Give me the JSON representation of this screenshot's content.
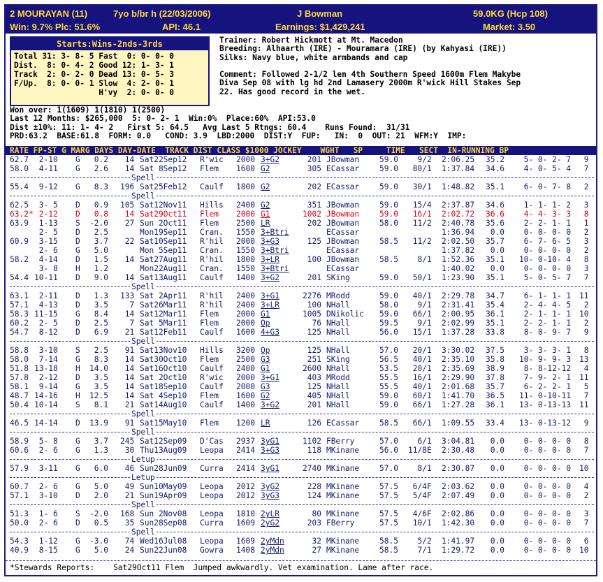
{
  "header": {
    "horse": "2 MOURAYAN (11)",
    "age_desc": "7yo b/br h (22/03/2006)",
    "jockey": "J Bowman",
    "weight": "59.0KG (Hcp 108)",
    "win_plc": "Win: 9.7% Plc: 51.6%",
    "api": "API: 46.1",
    "earnings": "Earnings: $1,429,241",
    "market": "Market: 3.50"
  },
  "starts_box": {
    "title": "Starts:Wins-2nds-3rds",
    "lines": [
      "Total 31: 3- 8- 5 Fast  0: 0- 0- 0",
      "Dist.  8: 0- 4- 2 Good 12: 1- 3- 1",
      "Track  2: 0- 2- 0 Dead 13: 0- 5- 3",
      "F/Up.  8: 0- 0- 1 Slow  4: 2- 0- 1",
      "                  H'vy  2: 0- 0- 0"
    ]
  },
  "info_lines": [
    "Trainer: Robert Hickmott at Mt. Macedon",
    "Breeding: Alhaarth (IRE) - Mouramara (IRE) (by Kahyasi (IRE))",
    "Silks: Navy blue, white armbands and cap",
    "",
    "Comment: Followed 2-1/2 len 4th Southern Speed 1600m Flem Makybe",
    "Diva Sep 08 with lg hd 2nd Lamasery 2000m R'wick Hill Stakes Sep",
    "22. Has good record in the wet."
  ],
  "summary_lines": [
    "Won over: 1(1609) 1(1810) 1(2500)",
    "Last 12 Months: $265,000  5: 0- 2- 1  Win:0%  Place:60%  API:53.0",
    "Dist ±10%: 11: 1- 4- 2   First 5: 64.5   Avg Last 5 Rtngs: 60.4    Runs Found:  31/31",
    "PRD:63.2  BASE:61.8  FORM: 0.0   COND: 3.9  LBD:2000  DIST:Y  FUP:   IN:  0  OUT: 21  WFM:Y  IMP:"
  ],
  "column_header": "RATE FP-ST G MARG DAYS DAY-DATE  TRACK DIST CLASS $1000 JOCKEY    WGHT   SP     TIME   SECT  IN-RUNNING BP",
  "form_rows": [
    {
      "t": "r",
      "rate": "62.7",
      "fpst": " 2-10",
      "g": "G",
      "marg": " 0.2",
      "days": " 14",
      "date": "Sat22Sep12",
      "track": "R'wic",
      "dist": "2000",
      "cls": "3+G2",
      "prize": " 201",
      "jockey": "JBowman",
      "wght": "59.0",
      "sp": "  9/2",
      "time": "2:06.25",
      "sect": "35.2",
      "run": " 5- 0- 2- 7",
      "bp": " 9"
    },
    {
      "t": "r",
      "rate": "58.0",
      "fpst": " 4-11",
      "g": "G",
      "marg": " 2.6",
      "days": " 14",
      "date": "Sat 8Sep12",
      "track": "Flem ",
      "dist": "1600",
      "cls": "G2",
      "prize": " 305",
      "jockey": "ECassar",
      "wght": "59.0",
      "sp": " 80/1",
      "time": "1:37.84",
      "sect": "34.6",
      "run": " 4- 0- 5- 4",
      "bp": " 7"
    },
    {
      "t": "s",
      "label": "Spell"
    },
    {
      "t": "r",
      "rate": "55.4",
      "fpst": " 9-12",
      "g": "G",
      "marg": " 8.3",
      "days": "196",
      "date": "Sat25Feb12",
      "track": "Caulf",
      "dist": "1800",
      "cls": "G2",
      "prize": " 202",
      "jockey": "ECassar",
      "wght": "59.0",
      "sp": " 30/1",
      "time": "1:48.82",
      "sect": "35.1",
      "run": " 6- 0- 7- 8",
      "bp": " 2"
    },
    {
      "t": "s",
      "label": "Spell"
    },
    {
      "t": "r",
      "rate": "62.5",
      "fpst": " 3- 5",
      "g": "D",
      "marg": " 0.9",
      "days": "105",
      "date": "Sat12Nov11",
      "track": "Hills",
      "dist": "2400",
      "cls": "G2",
      "prize": " 351",
      "jockey": "JBowman",
      "wght": "59.0",
      "sp": " 15/4",
      "time": "2:37.87",
      "sect": "34.6",
      "run": " 1- 1- 1- 2",
      "bp": " 3"
    },
    {
      "t": "r",
      "hl": true,
      "rate": "63.2*",
      "fpst": " 2-12",
      "g": "D",
      "marg": " 0.8",
      "days": " 14",
      "date": "Sat29Oct11",
      "track": "Flem ",
      "dist": "2000",
      "cls": "G1",
      "prize": "1002",
      "jockey": "JBowman",
      "wght": "59.0",
      "sp": " 16/1",
      "time": "2:02.72",
      "sect": "36.6",
      "run": " 4- 4- 3- 3",
      "bp": " 8"
    },
    {
      "t": "r",
      "rate": "63.9",
      "fpst": " 1-13",
      "g": "S",
      "marg": "-2.0",
      "days": " 27",
      "date": "Sun 2Oct11",
      "track": "Flem ",
      "dist": "2500",
      "cls": "LR",
      "prize": " 202",
      "jockey": "JBowman",
      "wght": "58.0",
      "sp": " 11/2",
      "time": "2:40.78",
      "sect": "35.6",
      "run": " 2- 2- 1- 1",
      "bp": " 1"
    },
    {
      "t": "r",
      "rate": "",
      "fpst": " 2- 5",
      "g": "D",
      "marg": " 2.5",
      "days": "",
      "date": "Mon19Sep11",
      "track": "Cran.",
      "dist": "1550",
      "cls": "3+Btri",
      "prize": "",
      "jockey": "ECassar",
      "wght": "",
      "sp": "",
      "time": "1:36.94",
      "sect": " 0.0",
      "run": " 0- 0- 0- 0",
      "bp": " 2"
    },
    {
      "t": "r",
      "rate": "60.9",
      "fpst": " 3-15",
      "g": "D",
      "marg": " 3.7",
      "days": " 22",
      "date": "Sat10Sep11",
      "track": "R'hil",
      "dist": "2000",
      "cls": "3+G3",
      "prize": " 125",
      "jockey": "JBowman",
      "wght": "58.5",
      "sp": " 11/2",
      "time": "2:02.50",
      "sect": "35.7",
      "run": " 6- 7- 6- 5",
      "bp": " 3"
    },
    {
      "t": "r",
      "rate": "",
      "fpst": " 2- 6",
      "g": "G",
      "marg": " 5.0",
      "days": "",
      "date": "Mon 5Sep11",
      "track": "Cran.",
      "dist": "1550",
      "cls": "3+Btri",
      "prize": "",
      "jockey": "ECassar",
      "wght": "",
      "sp": "",
      "time": "1:37.82",
      "sect": " 0.0",
      "run": " 0- 0- 0- 0",
      "bp": " 2"
    },
    {
      "t": "r",
      "rate": "58.2",
      "fpst": " 4-14",
      "g": "D",
      "marg": " 1.5",
      "days": " 14",
      "date": "Sat27Aug11",
      "track": "R'hil",
      "dist": "1800",
      "cls": "3+LR",
      "prize": " 100",
      "jockey": "JBowman",
      "wght": "58.5",
      "sp": "  8/1",
      "time": "1:52.36",
      "sect": "35.1",
      "run": "10- 0-10- 4",
      "bp": " 8"
    },
    {
      "t": "r",
      "rate": "",
      "fpst": " 3- 8",
      "g": "H",
      "marg": " 1.2",
      "days": "",
      "date": "Mon22Aug11",
      "track": "Cran.",
      "dist": "1550",
      "cls": "3+Btri",
      "prize": "",
      "jockey": "ECassar",
      "wght": "",
      "sp": "",
      "time": "1:40.02",
      "sect": " 0.0",
      "run": " 0- 0- 0- 0",
      "bp": " 3"
    },
    {
      "t": "r",
      "rate": "54.4",
      "fpst": "10-11",
      "g": "D",
      "marg": " 9.0",
      "days": " 14",
      "date": "Sat13Aug11",
      "track": "Caulf",
      "dist": "1400",
      "cls": "3+G2",
      "prize": " 201",
      "jockey": "SKing",
      "wght": "59.0",
      "sp": " 50/1",
      "time": "1:23.90",
      "sect": "35.1",
      "run": " 5- 0- 5- 7",
      "bp": " 7"
    },
    {
      "t": "s",
      "label": "Spell"
    },
    {
      "t": "r",
      "rate": "63.1",
      "fpst": " 2-11",
      "g": "D",
      "marg": " 1.3",
      "days": "133",
      "date": "Sat 2Apr11",
      "track": "R'hil",
      "dist": "2400",
      "cls": "3+G1",
      "prize": "2276",
      "jockey": "MRodd",
      "wght": "59.0",
      "sp": " 40/1",
      "time": "2:29.78",
      "sect": "34.7",
      "run": " 6- 1- 1- 1",
      "bp": "11"
    },
    {
      "t": "r",
      "rate": "57.1",
      "fpst": " 4-13",
      "g": "D",
      "marg": " 3.5",
      "days": "  7",
      "date": "Sat26Mar11",
      "track": "R'hil",
      "dist": "2400",
      "cls": "3+LR",
      "prize": " 100",
      "jockey": "NHall",
      "wght": "58.0",
      "sp": "  9/1",
      "time": "2:31.41",
      "sect": "35.4",
      "run": " 2- 4- 4- 5",
      "bp": " 2"
    },
    {
      "t": "r",
      "rate": "58.3",
      "fpst": "11-15",
      "g": "G",
      "marg": " 8.4",
      "days": " 14",
      "date": "Sat12Mar11",
      "track": "Flem ",
      "dist": "2000",
      "cls": "G1",
      "prize": "1005",
      "jockey": "DNikolic",
      "wght": "59.0",
      "sp": " 66/1",
      "time": "2:00.95",
      "sect": "36.1",
      "run": " 2- 1- 1- 1",
      "bp": "10"
    },
    {
      "t": "r",
      "rate": "60.2",
      "fpst": " 2- 5",
      "g": "D",
      "marg": " 2.5",
      "days": "  7",
      "date": "Sat 5Mar11",
      "track": "Flem ",
      "dist": "2000",
      "cls": "Op",
      "prize": "  76",
      "jockey": "NHall",
      "wght": "59.5",
      "sp": "  9/1",
      "time": "2:02.99",
      "sect": "35.1",
      "run": " 2- 2- 1- 1",
      "bp": " 2"
    },
    {
      "t": "r",
      "rate": "54.7",
      "fpst": " 8-12",
      "g": "D",
      "marg": " 6.9",
      "days": " 21",
      "date": "Sat12Feb11",
      "track": "Caulf",
      "dist": "1600",
      "cls": "4+G3",
      "prize": " 125",
      "jockey": "NHall",
      "wght": "56.0",
      "sp": " 15/1",
      "time": "1:37.28",
      "sect": "33.8",
      "run": " 8- 0- 9- 7",
      "bp": " 9"
    },
    {
      "t": "s",
      "label": "Spell"
    },
    {
      "t": "r",
      "rate": "58.8",
      "fpst": " 3-10",
      "g": "S",
      "marg": " 2.5",
      "days": " 91",
      "date": "Sat13Nov10",
      "track": "Hills",
      "dist": "3200",
      "cls": "Op",
      "prize": " 125",
      "jockey": "NHall",
      "wght": "57.0",
      "sp": " 20/1",
      "time": "3:30.02",
      "sect": "37.5",
      "run": " 3- 3- 3- 1",
      "bp": " 8"
    },
    {
      "t": "r",
      "rate": "58.0",
      "fpst": " 7-14",
      "g": "G",
      "marg": " 8.3",
      "days": " 14",
      "date": "Sat30Oct10",
      "track": "Flem ",
      "dist": "2500",
      "cls": "G3",
      "prize": " 251",
      "jockey": "SKing",
      "wght": "56.5",
      "sp": " 40/1",
      "time": "2:35.10",
      "sect": "35.8",
      "run": "10- 9- 9- 3",
      "bp": "13"
    },
    {
      "t": "r",
      "rate": "51.8",
      "fpst": "13-18",
      "g": "H",
      "marg": "14.0",
      "days": " 14",
      "date": "Sat16Oct10",
      "track": "Caulf",
      "dist": "2400",
      "cls": "G1",
      "prize": "2600",
      "jockey": "NHall",
      "wght": "53.5",
      "sp": " 20/1",
      "time": "2:35.69",
      "sect": "38.9",
      "run": " 8- 8-12-12",
      "bp": " 4"
    },
    {
      "t": "r",
      "rate": "57.8",
      "fpst": " 2-12",
      "g": "D",
      "marg": " 3.5",
      "days": " 14",
      "date": "Sat 2Oct10",
      "track": "R'wic",
      "dist": "2000",
      "cls": "3+G1",
      "prize": " 403",
      "jockey": "MRodd",
      "wght": "55.5",
      "sp": " 16/1",
      "time": "2:29.90",
      "sect": "37.8",
      "run": " 7- 9- 2- 1",
      "bp": "11"
    },
    {
      "t": "r",
      "rate": "58.1",
      "fpst": " 9-14",
      "g": "G",
      "marg": " 3.5",
      "days": " 14",
      "date": "Sat18Sep10",
      "track": "Caulf",
      "dist": "2000",
      "cls": "G3",
      "prize": " 125",
      "jockey": "NHall",
      "wght": "55.5",
      "sp": " 40/1",
      "time": "2:01.68",
      "sect": "35.7",
      "run": " 6- 2- 2- 1",
      "bp": " 5"
    },
    {
      "t": "r",
      "rate": "48.7",
      "fpst": "14-16",
      "g": "H",
      "marg": "12.5",
      "days": " 14",
      "date": "Sat 4Sep10",
      "track": "Flem ",
      "dist": "1600",
      "cls": "G2",
      "prize": " 405",
      "jockey": "NHall",
      "wght": "59.0",
      "sp": " 60/1",
      "time": "1:41.70",
      "sect": "36.5",
      "run": "11- 0-10-11",
      "bp": " 7"
    },
    {
      "t": "r",
      "rate": "50.4",
      "fpst": "10-14",
      "g": "S",
      "marg": " 8.1",
      "days": " 21",
      "date": "Sat14Aug10",
      "track": "Caulf",
      "dist": "1400",
      "cls": "3+G2",
      "prize": " 201",
      "jockey": "NHall",
      "wght": "59.0",
      "sp": " 66/1",
      "time": "1:27.28",
      "sect": "36.1",
      "run": "13- 0-13-13",
      "bp": "11"
    },
    {
      "t": "s",
      "label": "Spell"
    },
    {
      "t": "r",
      "rate": "46.5",
      "fpst": "14-14",
      "g": "D",
      "marg": "13.9",
      "days": " 91",
      "date": "Sat15May10",
      "track": "Flem ",
      "dist": "1200",
      "cls": "LR",
      "prize": " 126",
      "jockey": "ECassar",
      "wght": "58.5",
      "sp": " 66/1",
      "time": "1:09.55",
      "sect": "33.4",
      "run": "13- 0-13-12",
      "bp": " 9"
    },
    {
      "t": "s",
      "label": "Spell"
    },
    {
      "t": "r",
      "rate": "58.9",
      "fpst": " 5- 8",
      "g": "G",
      "marg": " 3.7",
      "days": "245",
      "date": "Sat12Sep09",
      "track": "D'Cas",
      "dist": "2937",
      "cls": "3yG1",
      "prize": "1102",
      "jockey": "FBerry",
      "wght": "57.0",
      "sp": "  6/1",
      "time": "3:04.81",
      "sect": " 0.0",
      "run": " 0- 0- 0- 0",
      "bp": " 8"
    },
    {
      "t": "r",
      "rate": "60.6",
      "fpst": " 2- 6",
      "g": "G",
      "marg": " 1.3",
      "days": " 30",
      "date": "Thu13Aug09",
      "track": "Leopa",
      "dist": "2414",
      "cls": "3+G3",
      "prize": " 118",
      "jockey": "MKinane",
      "wght": "56.0",
      "sp": "11/8E",
      "time": "2:30.48",
      "sect": " 0.0",
      "run": " 0- 0- 0- 0",
      "bp": " 7"
    },
    {
      "t": "s",
      "label": "Letup"
    },
    {
      "t": "r",
      "rate": "57.9",
      "fpst": " 3-11",
      "g": "G",
      "marg": " 6.0",
      "days": " 46",
      "date": "Sun28Jun09",
      "track": "Curra",
      "dist": "2414",
      "cls": "3yG1",
      "prize": "2740",
      "jockey": "MKinane",
      "wght": "57.0",
      "sp": "  8/1",
      "time": "2:30.87",
      "sect": " 0.0",
      "run": " 0- 0- 0- 0",
      "bp": "10"
    },
    {
      "t": "s",
      "label": "Letup"
    },
    {
      "t": "r",
      "rate": "60.7",
      "fpst": " 2- 6",
      "g": "G",
      "marg": " 5.0",
      "days": " 49",
      "date": "Sun10May09",
      "track": "Leopa",
      "dist": "2012",
      "cls": "3yG2",
      "prize": " 228",
      "jockey": "MKinane",
      "wght": "57.5",
      "sp": " 6/4F",
      "time": "2:03.62",
      "sect": " 0.0",
      "run": " 0- 0- 0- 0",
      "bp": " 4"
    },
    {
      "t": "r",
      "rate": "57.1",
      "fpst": " 3-10",
      "g": "D",
      "marg": " 2.0",
      "days": " 21",
      "date": "Sun19Apr09",
      "track": "Leopa",
      "dist": "2012",
      "cls": "3yG3",
      "prize": " 124",
      "jockey": "MKinane",
      "wght": "57.5",
      "sp": " 5/4F",
      "time": "2:07.49",
      "sect": " 0.0",
      "run": " 0- 0- 0- 0",
      "bp": " 2"
    },
    {
      "t": "s",
      "label": "Spell"
    },
    {
      "t": "r",
      "rate": "51.3",
      "fpst": " 1- 6",
      "g": "S",
      "marg": "-2.0",
      "days": "168",
      "date": "Sun 2Nov08",
      "track": "Leopa",
      "dist": "1810",
      "cls": "2yLR",
      "prize": "  80",
      "jockey": "MKinane",
      "wght": "57.5",
      "sp": " 4/6F",
      "time": "2:02.86",
      "sect": " 0.0",
      "run": " 0- 0- 0- 0",
      "bp": " 3"
    },
    {
      "t": "r",
      "rate": "50.0",
      "fpst": " 2- 6",
      "g": "D",
      "marg": " 0.5",
      "days": " 35",
      "date": "Sun28Sep08",
      "track": "Curra",
      "dist": "1609",
      "cls": "2yG2",
      "prize": " 203",
      "jockey": "FBerry",
      "wght": "57.5",
      "sp": " 10/1",
      "time": "1:42.30",
      "sect": " 0.0",
      "run": " 0- 0- 0- 0",
      "bp": " 7"
    },
    {
      "t": "s",
      "label": "Spell"
    },
    {
      "t": "r",
      "rate": "54.3",
      "fpst": " 1-12",
      "g": "G",
      "marg": "-3.0",
      "days": " 74",
      "date": "Wed16Jul08",
      "track": "Leopa",
      "dist": "1609",
      "cls": "2yMdn",
      "prize": "  32",
      "jockey": "MKinane",
      "wght": "58.5",
      "sp": "  5/2",
      "time": "1:41.97",
      "sect": " 0.0",
      "run": " 0- 0- 0- 0",
      "bp": " 6"
    },
    {
      "t": "r",
      "rate": "40.9",
      "fpst": " 8-15",
      "g": "G",
      "marg": " 5.0",
      "days": " 24",
      "date": "Sun22Jun08",
      "track": "Gowra",
      "dist": "1408",
      "cls": "2yMdn",
      "prize": "  27",
      "jockey": "MKinane",
      "wght": "58.5",
      "sp": "  7/1",
      "time": "1:29.72",
      "sect": " 0.0",
      "run": " 0- 0- 0- 0",
      "bp": "10"
    }
  ],
  "stewards": "*Stewards Reports:    Sat29Oct11 Flem  Jumped awkwardly. Vet examination. Lame after race.",
  "colors": {
    "header_bg": "#16137f",
    "header_text": "#ffd83a",
    "row_text": "#111b6e",
    "highlight_row": "#e0001a",
    "starts_bg": "#fff6c2"
  }
}
